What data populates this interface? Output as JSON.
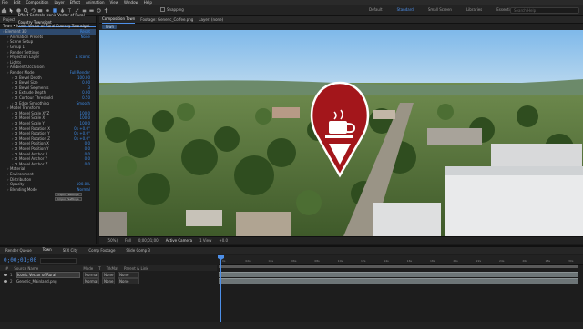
{
  "menu": [
    "File",
    "Edit",
    "Composition",
    "Layer",
    "Effect",
    "Animation",
    "View",
    "Window",
    "Help"
  ],
  "toolbar": {
    "snapping_label": "Snapping",
    "workspaces": [
      "Default",
      "Standard",
      "Small Screen",
      "Libraries",
      "Essentials"
    ],
    "active_workspace": "Standard",
    "search_placeholder": "Search Help"
  },
  "left_panel": {
    "tabs": [
      "Project",
      "Effect Controls Iconic Vector of Rural Country Townsignt"
    ],
    "header": "Town • Iconic Vector of Rural Country Townsignt",
    "rows": [
      {
        "label": "Element 3D",
        "value": "Reset",
        "selected": true,
        "indent": 0
      },
      {
        "label": "Animation Presets",
        "value": "None",
        "indent": 1
      },
      {
        "label": "Scene Setup",
        "value": "",
        "indent": 1
      },
      {
        "label": "Group 1",
        "value": "",
        "indent": 1
      },
      {
        "label": "Render Settings",
        "value": "",
        "indent": 1
      },
      {
        "label": "Projection Layer",
        "value": "1. Iconic",
        "indent": 1
      },
      {
        "label": "Lights",
        "value": "",
        "indent": 1
      },
      {
        "label": "Ambient Occlusion",
        "value": "",
        "indent": 1
      },
      {
        "label": "Render Mode",
        "value": "Full Render",
        "indent": 1
      },
      {
        "label": "Bevel Depth",
        "value": "100.00",
        "indent": 2
      },
      {
        "label": "Bevel Size",
        "value": "0.00",
        "indent": 2
      },
      {
        "label": "Bevel Segments",
        "value": "3",
        "indent": 2
      },
      {
        "label": "Extrude Depth",
        "value": "0.00",
        "indent": 2
      },
      {
        "label": "Contour Threshold",
        "value": "0.50",
        "indent": 2
      },
      {
        "label": "Edge Smoothing",
        "value": "Smooth",
        "indent": 2
      },
      {
        "label": "Model Transform",
        "value": "",
        "indent": 1
      },
      {
        "label": "Model Scale XYZ",
        "value": "100.0",
        "indent": 2
      },
      {
        "label": "Model Scale X",
        "value": "100.0",
        "indent": 2
      },
      {
        "label": "Model Scale Y",
        "value": "100.0",
        "indent": 2
      },
      {
        "label": "Model Rotation X",
        "value": "0x +0.0°",
        "indent": 2
      },
      {
        "label": "Model Rotation Y",
        "value": "0x +0.0°",
        "indent": 2
      },
      {
        "label": "Model Rotation Z",
        "value": "0x +0.0°",
        "indent": 2
      },
      {
        "label": "Model Position X",
        "value": "0.0",
        "indent": 2
      },
      {
        "label": "Model Position Y",
        "value": "0.0",
        "indent": 2
      },
      {
        "label": "Model Anchor X",
        "value": "0.0",
        "indent": 2
      },
      {
        "label": "Model Anchor Y",
        "value": "0.0",
        "indent": 2
      },
      {
        "label": "Model Anchor Z",
        "value": "0.0",
        "indent": 2
      },
      {
        "label": "Material",
        "value": "",
        "indent": 1
      },
      {
        "label": "Environment",
        "value": "",
        "indent": 1
      },
      {
        "label": "Distribution",
        "value": "",
        "indent": 1
      },
      {
        "label": "Opacity",
        "value": "100.0%",
        "indent": 1
      },
      {
        "label": "Blending Mode",
        "value": "Normal",
        "indent": 1
      }
    ],
    "buttons": [
      "Export Settings",
      "Import Settings"
    ]
  },
  "comp_panel": {
    "tabs": [
      "Composition Town",
      "Footage: Generic_Coffee.png",
      "Layer: (none)"
    ],
    "sub_tab": "Town",
    "viewer_bar": [
      "(50%)",
      "Full",
      "0;00;01;00",
      "Active Camera",
      "1 View",
      "+0.0"
    ]
  },
  "timeline": {
    "tabs": [
      "Render Queue",
      "Town",
      "SFX City",
      "Comp Footage",
      "Slide Comp 3"
    ],
    "active_tab": "Town",
    "timecode": "0;00;01;00",
    "columns": [
      "#",
      "Source Name",
      "Mode",
      "T",
      "TrkMat",
      "Parent & Link"
    ],
    "layers": [
      {
        "num": "1",
        "name": "Iconic Vector of Rural",
        "mode": "Normal",
        "trk": "None",
        "parent": "None",
        "selected": true
      },
      {
        "num": "2",
        "name": "Generic_Mainland.png",
        "mode": "Normal",
        "trk": "None",
        "parent": "None",
        "selected": false
      }
    ],
    "ruler_ticks": [
      "0s",
      "02s",
      "04s",
      "06s",
      "08s",
      "10s",
      "12s",
      "14s",
      "16s",
      "18s",
      "20s",
      "22s",
      "24s",
      "26s",
      "28s",
      "30s"
    ]
  },
  "colors": {
    "accent": "#4d8fe8",
    "marker_red": "#a3161b",
    "sky": "#8fc6f0"
  }
}
